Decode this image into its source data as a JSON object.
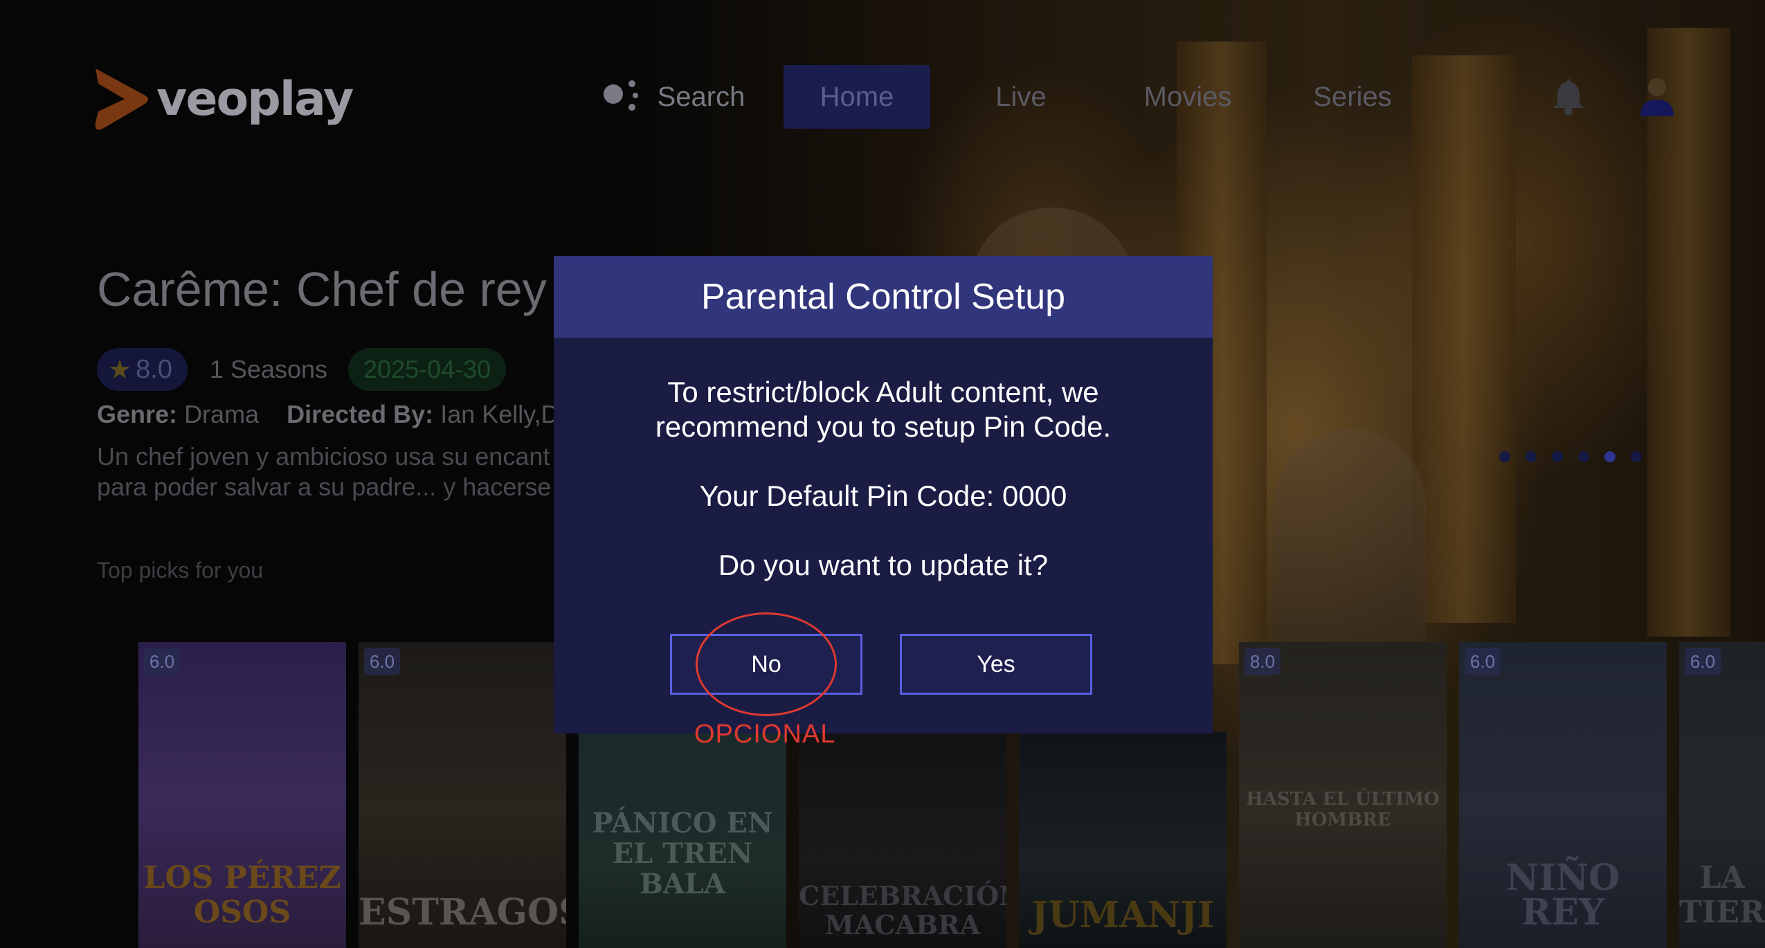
{
  "app": {
    "logo_text": "veoplay"
  },
  "nav": {
    "search": "Search",
    "home": "Home",
    "live": "Live",
    "movies": "Movies",
    "series": "Series"
  },
  "hero": {
    "title": "Carême: Chef de rey",
    "rating": "8.0",
    "seasons": "1 Seasons",
    "date": "2025-04-30",
    "genre_label": "Genre:",
    "genre_value": "Drama",
    "directed_label": "Directed By:",
    "directed_value": "Ian Kelly,Dav",
    "description_line1": "Un chef joven y ambicioso usa su encant",
    "description_line2": "para poder salvar a su padre... y hacerse"
  },
  "row": {
    "title": "Top picks for you"
  },
  "posters": [
    {
      "rating": "6.0",
      "title": "LOS PÉREZ OSOS"
    },
    {
      "rating": "6.0",
      "title": "ESTRAGOS"
    },
    {
      "rating": "",
      "title": "PÁNICO EN EL TREN BALA"
    },
    {
      "rating": "",
      "title": "CELEBRACIÓN MACABRA"
    },
    {
      "rating": "",
      "title": "JUMANJI"
    },
    {
      "rating": "8.0",
      "title": "HASTA EL ÚLTIMO HOMBRE"
    },
    {
      "rating": "6.0",
      "title": "NIÑO REY"
    },
    {
      "rating": "6.0",
      "title": "LA TIERRA"
    }
  ],
  "modal": {
    "title": "Parental Control Setup",
    "message_line1": "To restrict/block Adult content, we",
    "message_line2": "recommend you to setup Pin Code.",
    "default_pin": "Your Default Pin Code: 0000",
    "question": "Do you want to update it?",
    "no_label": "No",
    "yes_label": "Yes"
  },
  "annotation": {
    "label": "OPCIONAL",
    "color": "#e0392f"
  },
  "colors": {
    "modal_bg": "#1a1c44",
    "modal_header": "#31357b",
    "button_border": "#5a5fe0",
    "logo_accent": "#c2571c"
  }
}
